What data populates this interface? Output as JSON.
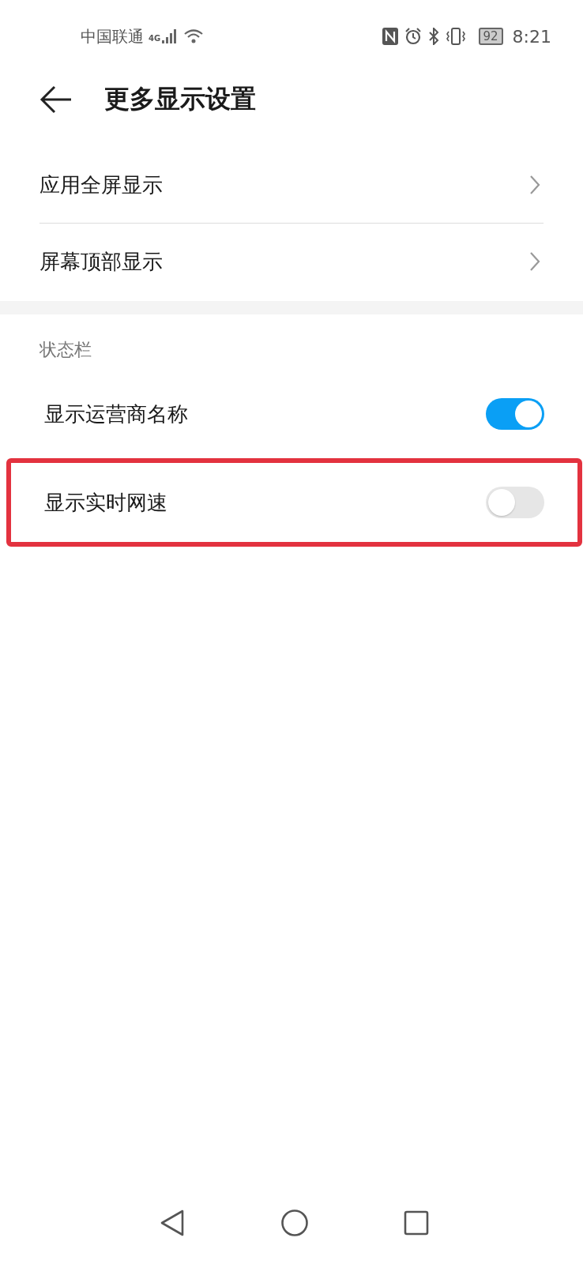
{
  "status_bar": {
    "carrier": "中国联通",
    "network": "4G",
    "battery": "92",
    "time": "8:21"
  },
  "header": {
    "title": "更多显示设置"
  },
  "groups": [
    {
      "items": [
        {
          "kind": "link",
          "label": "应用全屏显示"
        },
        {
          "kind": "link",
          "label": "屏幕顶部显示"
        }
      ]
    },
    {
      "section": "状态栏",
      "items": [
        {
          "kind": "toggle",
          "label": "显示运营商名称",
          "on": true
        },
        {
          "kind": "toggle",
          "label": "显示实时网速",
          "on": false,
          "highlighted": true
        }
      ]
    }
  ]
}
